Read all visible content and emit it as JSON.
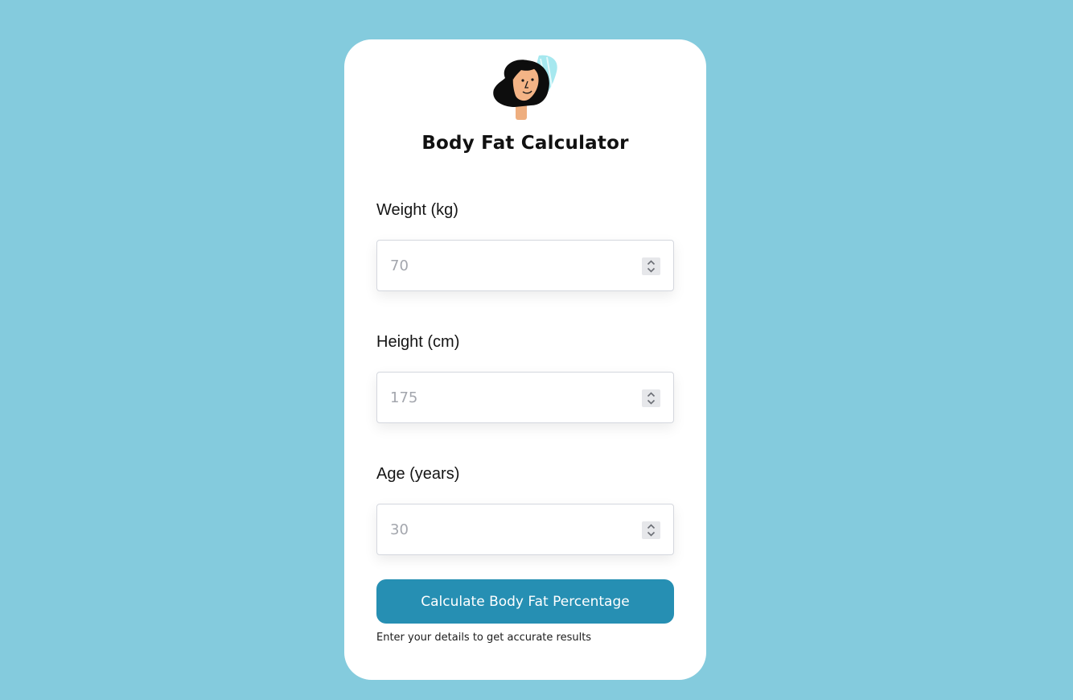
{
  "page": {
    "background": "#84cbdd"
  },
  "header": {
    "avatar_icon": "woman-avatar-icon",
    "title": "Body Fat Calculator"
  },
  "form": {
    "fields": [
      {
        "label": "Weight (kg)",
        "placeholder": "70",
        "value": ""
      },
      {
        "label": "Height (cm)",
        "placeholder": "175",
        "value": ""
      },
      {
        "label": "Age (years)",
        "placeholder": "30",
        "value": ""
      }
    ],
    "stepper_icon": "chevron-up-down-icon",
    "submit_label": "Calculate Body Fat Percentage",
    "hint": "Enter your details to get accurate results"
  },
  "colors": {
    "accent": "#268fb3",
    "card": "#ffffff"
  }
}
